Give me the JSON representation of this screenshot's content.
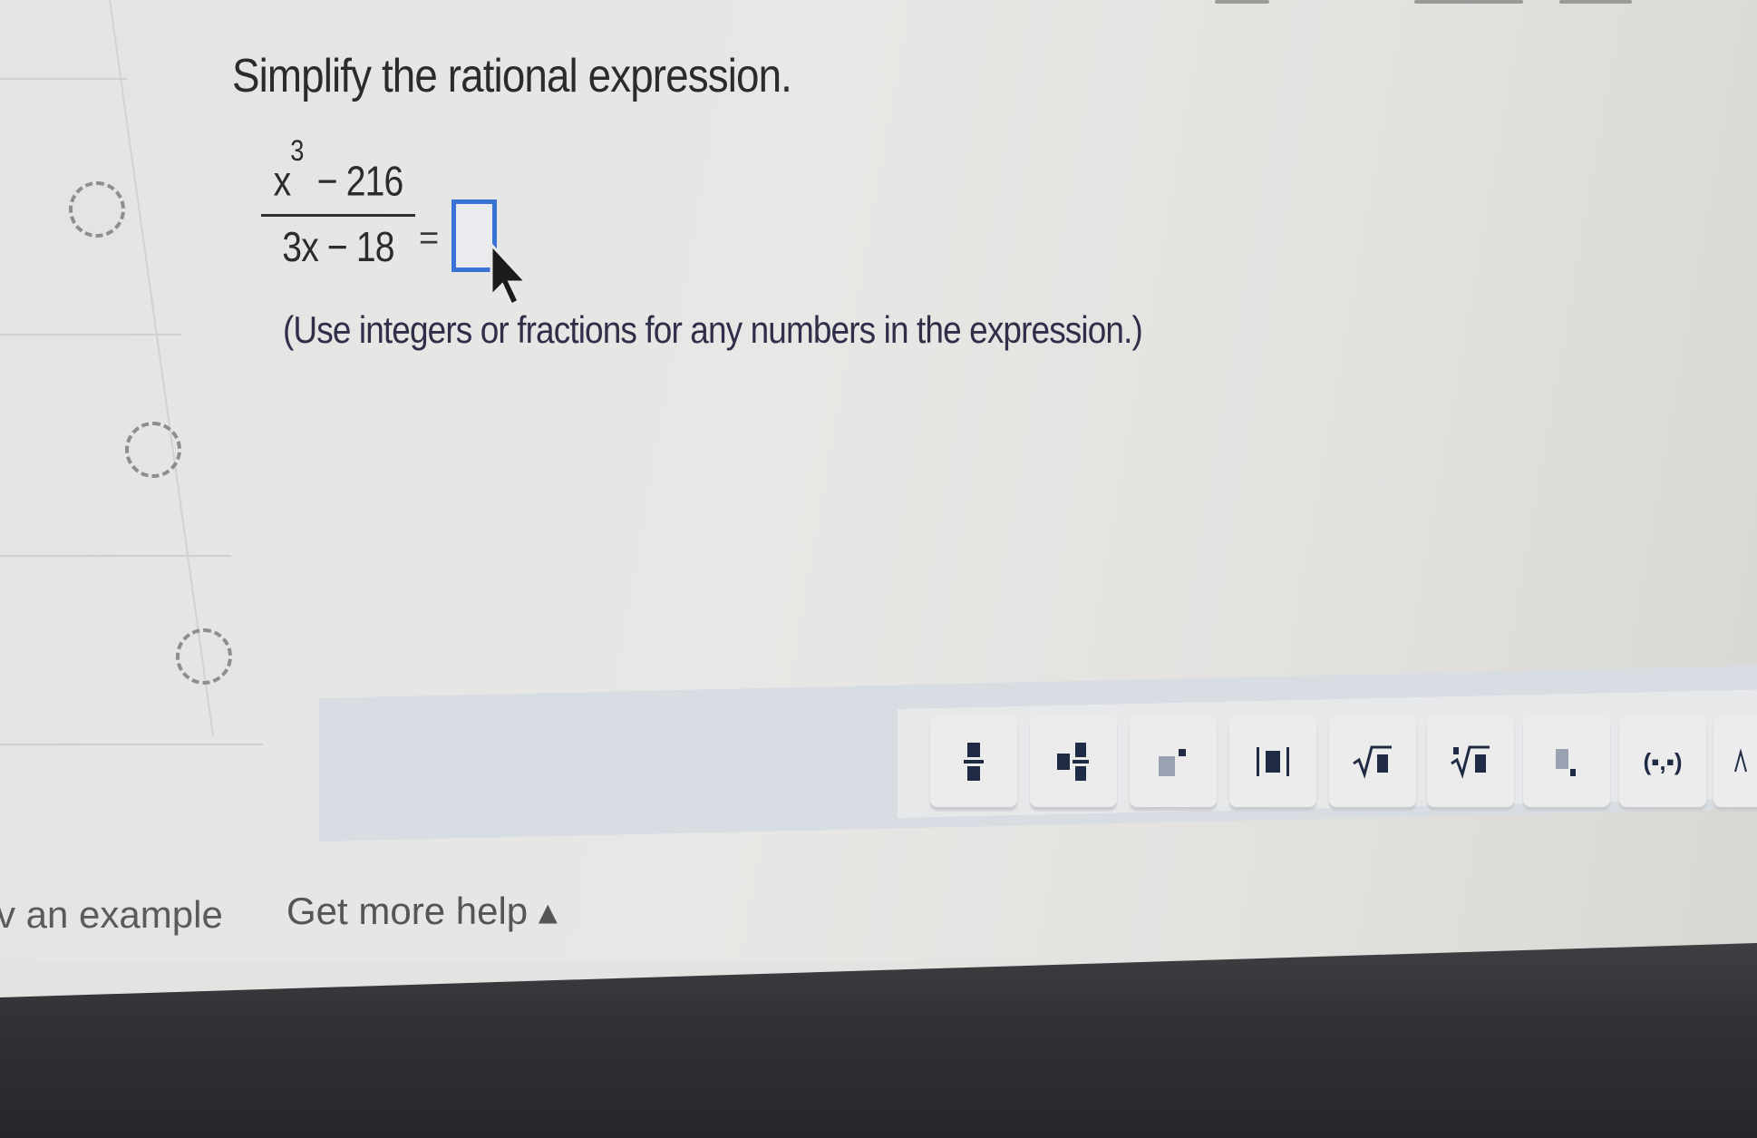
{
  "question": {
    "title": "Simplify the rational expression.",
    "numerator_base": "x",
    "numerator_exponent": "3",
    "numerator_rest": " − 216",
    "denominator": "3x − 18",
    "equals": "=",
    "instruction": "(Use integers or fractions for any numbers in the expression.)"
  },
  "footer": {
    "view_example": "v an example",
    "get_more_help": "Get more help ▴"
  },
  "palette": {
    "tools": [
      "fraction-icon",
      "mixed-number-icon",
      "exponent-icon",
      "absolute-value-icon",
      "square-root-icon",
      "nth-root-icon",
      "subscript-icon",
      "ordered-pair-icon"
    ],
    "ordered_pair_label": "(▪,▪)"
  },
  "colors": {
    "answer_box_border": "#3a72d6",
    "palette_bg": "#d8dde3",
    "tool_icon": "#1f2a44"
  }
}
